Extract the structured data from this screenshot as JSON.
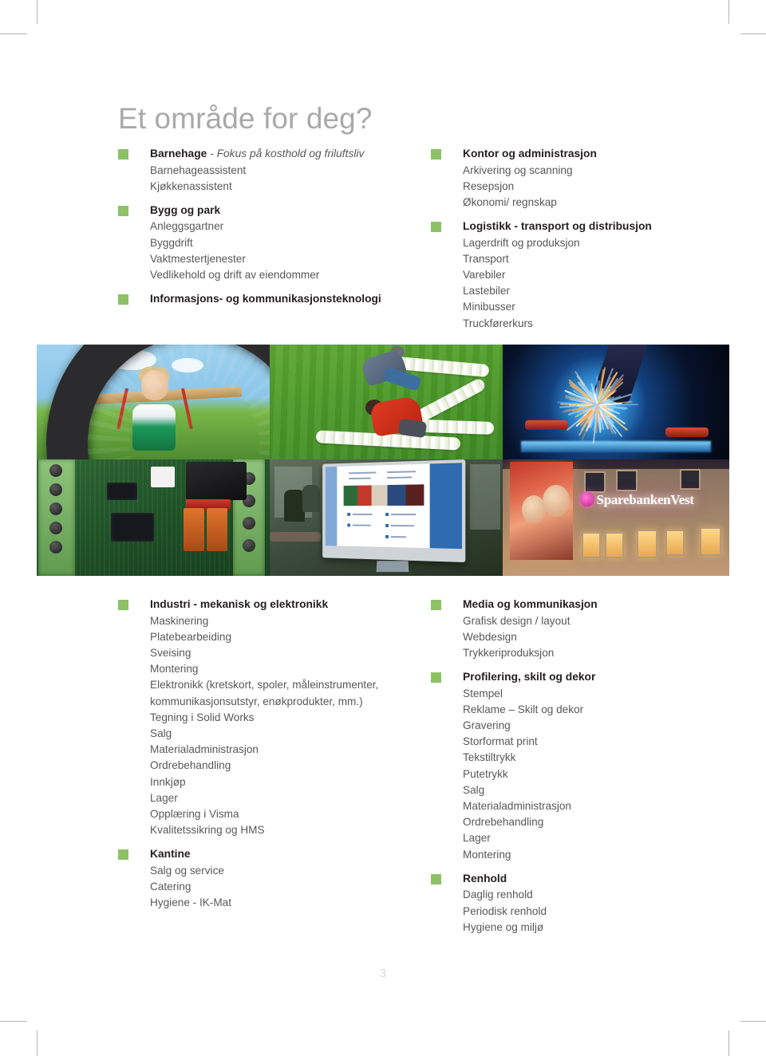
{
  "page": {
    "heading": "Et område for deg?",
    "number": "3",
    "accent_color": "#8cc265",
    "body_text_color": "#58585a",
    "heading_color": "#a9a9a9"
  },
  "columns": {
    "top_left": [
      {
        "title": "Barnehage",
        "subtitle": " - Fokus på kosthold og friluftsliv",
        "items": [
          "Barnehageassistent",
          "Kjøkkenassistent"
        ]
      },
      {
        "title": "Bygg og park",
        "subtitle": "",
        "items": [
          "Anleggsgartner",
          "Byggdrift",
          "Vaktmestertjenester",
          "Vedlikehold og drift av eiendommer"
        ]
      },
      {
        "title": "Informasjons- og kommunikasjonsteknologi",
        "subtitle": "",
        "items": []
      }
    ],
    "top_right": [
      {
        "title": "Kontor og administrasjon",
        "subtitle": "",
        "items": [
          "Arkivering og scanning",
          "Resepsjon",
          "Økonomi/ regnskap"
        ]
      },
      {
        "title": "Logistikk - transport og distribusjon",
        "subtitle": "",
        "items": [
          "Lagerdrift og produksjon",
          "Transport",
          "Varebiler",
          "Lastebiler",
          "Minibusser",
          "Truckførerkurs"
        ]
      }
    ],
    "bottom_left": [
      {
        "title": "Industri - mekanisk og elektronikk",
        "subtitle": "",
        "items": [
          "Maskinering",
          "Platebearbeiding",
          "Sveising",
          "Montering",
          "Elektronikk (kretskort, spoler, måleinstrumenter, kommunikasjonsutstyr, enøkprodukter, mm.)",
          "Tegning i Solid Works",
          "Salg",
          "Materialadministrasjon",
          "Ordrebehandling",
          "Innkjøp",
          "Lager",
          "Opplæring i Visma",
          "Kvalitetssikring og HMS"
        ]
      },
      {
        "title": "Kantine",
        "subtitle": "",
        "items": [
          "Salg og service",
          "Catering",
          "Hygiene - IK-Mat"
        ]
      }
    ],
    "bottom_right": [
      {
        "title": "Media og kommunikasjon",
        "subtitle": "",
        "items": [
          "Grafisk design / layout",
          "Webdesign",
          "Trykkeriproduksjon"
        ]
      },
      {
        "title": "Profilering, skilt og dekor",
        "subtitle": "",
        "items": [
          "Stempel",
          "Reklame – Skilt og dekor",
          "Gravering",
          "Storformat print",
          "Tekstiltrykk",
          "Putetrykk",
          "Salg",
          "Materialadministrasjon",
          "Ordrebehandling",
          "Lager",
          "Montering"
        ]
      },
      {
        "title": "Renhold",
        "subtitle": "",
        "items": [
          "Daglig renhold",
          "Periodisk renhold",
          "Hygiene og miljø"
        ]
      }
    ]
  },
  "photos": [
    {
      "id": "photo-child-tyre-swing",
      "caption": "Child smiling through a tyre swing on a playground"
    },
    {
      "id": "photo-gardeners-planting",
      "caption": "Two gardeners planting white flowers on a lawn"
    },
    {
      "id": "photo-welding-sparks",
      "caption": "Welding torch with bright blue arc and sparks"
    },
    {
      "id": "photo-circuit-board",
      "caption": "Green PCB controller board with terminal blocks"
    },
    {
      "id": "photo-monitor-layout",
      "caption": "Computer monitor showing a page layout application"
    },
    {
      "id": "photo-building-sign",
      "caption": "Building facade at night with illuminated Sparebanken Vest sign"
    }
  ],
  "photo_sign_text": "SparebankenVest"
}
